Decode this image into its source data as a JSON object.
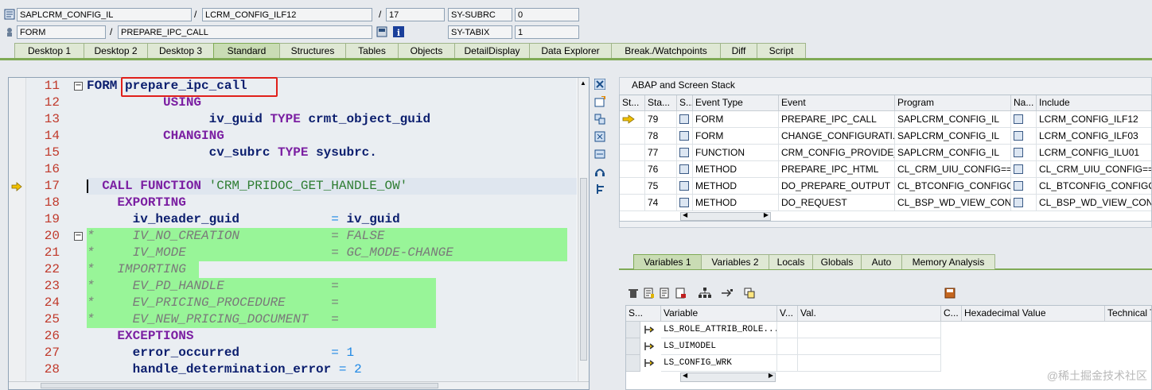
{
  "header": {
    "program": "SAPLCRM_CONFIG_IL",
    "include": "LCRM_CONFIG_ILF12",
    "line": "17",
    "subrc_label": "SY-SUBRC",
    "subrc_value": "0",
    "event_type": "FORM",
    "event_name": "PREPARE_IPC_CALL",
    "tabix_label": "SY-TABIX",
    "tabix_value": "1",
    "sep1": "/",
    "sep2": "/",
    "sep3": "/"
  },
  "tabs": [
    "Desktop 1",
    "Desktop 2",
    "Desktop 3",
    "Standard",
    "Structures",
    "Tables",
    "Objects",
    "DetailDisplay",
    "Data Explorer",
    "Break./Watchpoints",
    "Diff",
    "Script"
  ],
  "active_tab": "Standard",
  "code": {
    "lines": [
      {
        "n": "11",
        "segs": [
          {
            "t": "FORM ",
            "c": "id"
          },
          {
            "t": "prepare_ipc_call",
            "c": "id"
          }
        ]
      },
      {
        "n": "12",
        "segs": [
          {
            "t": "          USING",
            "c": "kw"
          }
        ]
      },
      {
        "n": "13",
        "segs": [
          {
            "t": "                iv_guid ",
            "c": "id"
          },
          {
            "t": "TYPE ",
            "c": "kw"
          },
          {
            "t": "crmt_object_guid",
            "c": "id"
          }
        ]
      },
      {
        "n": "14",
        "segs": [
          {
            "t": "          CHANGING",
            "c": "kw"
          }
        ]
      },
      {
        "n": "15",
        "segs": [
          {
            "t": "                cv_subrc ",
            "c": "id"
          },
          {
            "t": "TYPE ",
            "c": "kw"
          },
          {
            "t": "sysubrc.",
            "c": "id"
          }
        ]
      },
      {
        "n": "16",
        "segs": []
      },
      {
        "n": "17",
        "segs": [
          {
            "t": "  CALL FUNCTION ",
            "c": "kw"
          },
          {
            "t": "'CRM_PRIDOC_GET_HANDLE_OW'",
            "c": "str"
          }
        ]
      },
      {
        "n": "18",
        "segs": [
          {
            "t": "    EXPORTING",
            "c": "kw"
          }
        ]
      },
      {
        "n": "19",
        "segs": [
          {
            "t": "      iv_header_guid            ",
            "c": "id"
          },
          {
            "t": "= ",
            "c": "op"
          },
          {
            "t": "iv_guid",
            "c": "id"
          }
        ]
      },
      {
        "n": "20",
        "segs": [
          {
            "t": "*     IV_NO_CREATION            = FALSE",
            "c": "cm"
          }
        ]
      },
      {
        "n": "21",
        "segs": [
          {
            "t": "*     IV_MODE                   = GC_MODE-CHANGE",
            "c": "cm"
          }
        ]
      },
      {
        "n": "22",
        "segs": [
          {
            "t": "*   IMPORTING",
            "c": "cm"
          }
        ]
      },
      {
        "n": "23",
        "segs": [
          {
            "t": "*     EV_PD_HANDLE              =",
            "c": "cm"
          }
        ]
      },
      {
        "n": "24",
        "segs": [
          {
            "t": "*     EV_PRICING_PROCEDURE      =",
            "c": "cm"
          }
        ]
      },
      {
        "n": "25",
        "segs": [
          {
            "t": "*     EV_NEW_PRICING_DOCUMENT   =",
            "c": "cm"
          }
        ]
      },
      {
        "n": "26",
        "segs": [
          {
            "t": "    EXCEPTIONS",
            "c": "kw"
          }
        ]
      },
      {
        "n": "27",
        "segs": [
          {
            "t": "      error_occurred            ",
            "c": "id"
          },
          {
            "t": "= 1",
            "c": "num"
          }
        ]
      },
      {
        "n": "28",
        "segs": [
          {
            "t": "      handle_determination_error ",
            "c": "id"
          },
          {
            "t": "= 2",
            "c": "num"
          }
        ]
      }
    ]
  },
  "stack": {
    "title": "ABAP and Screen Stack",
    "headers": [
      "St...",
      "Sta...",
      "S...",
      "Event Type",
      "Event",
      "Program",
      "Na...",
      "Include"
    ],
    "rows": [
      {
        "level": "79",
        "type": "FORM",
        "event": "PREPARE_IPC_CALL",
        "program": "SAPLCRM_CONFIG_IL",
        "include": "LCRM_CONFIG_ILF12",
        "current": true
      },
      {
        "level": "78",
        "type": "FORM",
        "event": "CHANGE_CONFIGURATI...",
        "program": "SAPLCRM_CONFIG_IL",
        "include": "LCRM_CONFIG_ILF03",
        "current": false
      },
      {
        "level": "77",
        "type": "FUNCTION",
        "event": "CRM_CONFIG_PROVIDE_...",
        "program": "SAPLCRM_CONFIG_IL",
        "include": "LCRM_CONFIG_ILU01",
        "current": false
      },
      {
        "level": "76",
        "type": "METHOD",
        "event": "PREPARE_IPC_HTML",
        "program": "CL_CRM_UIU_CONFIG==...",
        "include": "CL_CRM_UIU_CONFIG==...",
        "current": false
      },
      {
        "level": "75",
        "type": "METHOD",
        "event": "DO_PREPARE_OUTPUT",
        "program": "CL_BTCONFIG_CONFIGO...",
        "include": "CL_BTCONFIG_CONFIGO...",
        "current": false
      },
      {
        "level": "74",
        "type": "METHOD",
        "event": "DO_REQUEST",
        "program": "CL_BSP_WD_VIEW_CON...",
        "include": "CL_BSP_WD_VIEW_CON...",
        "current": false
      }
    ]
  },
  "var_tabs": [
    "Variables 1",
    "Variables 2",
    "Locals",
    "Globals",
    "Auto",
    "Memory Analysis"
  ],
  "variables": {
    "headers": [
      "S...",
      "Variable",
      "V...",
      "Val.",
      "C...",
      "Hexadecimal Value",
      "Technical T"
    ],
    "rows": [
      {
        "name": "LS_ROLE_ATTRIB_ROLE..."
      },
      {
        "name": "LS_UIMODEL"
      },
      {
        "name": "LS_CONFIG_WRK"
      }
    ]
  },
  "watermark": "@稀土掘金技术社区",
  "colors": {
    "tab_accent": "#7faa55",
    "comment_bg": "#98f598",
    "highlight_border": "#e0201b"
  }
}
